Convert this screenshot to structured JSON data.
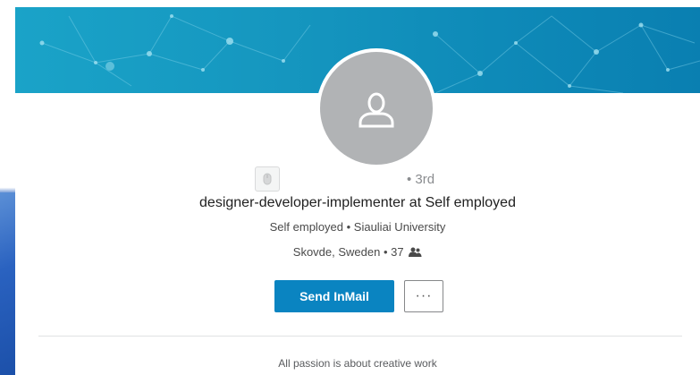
{
  "profile": {
    "degree": "• 3rd",
    "headline": "designer-developer-implementer at Self employed",
    "work_edu": "Self employed • Siauliai University",
    "location": "Skovde, Sweden • 37",
    "summary": "All passion is about creative work"
  },
  "actions": {
    "send_inmail": "Send InMail",
    "more": "···"
  },
  "colors": {
    "banner": "#1596bf",
    "primary_button": "#0a84c1",
    "avatar_bg": "#b1b3b5"
  },
  "icons": {
    "avatar": "person-silhouette-icon",
    "badge": "premium-badge-icon",
    "connections": "connections-icon"
  }
}
